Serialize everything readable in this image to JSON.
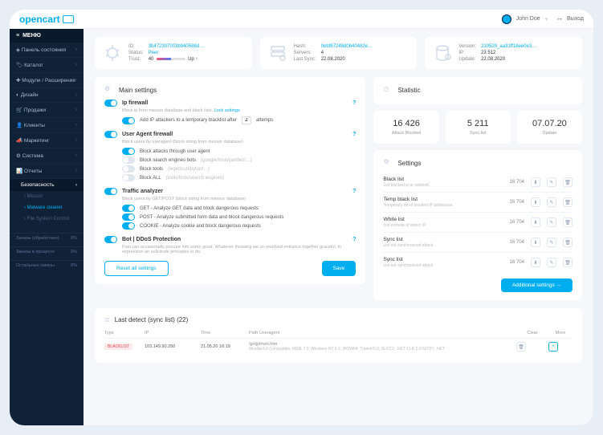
{
  "brand": "opencart",
  "user": {
    "name": "John Doe",
    "exit": "Выход"
  },
  "sidebar": {
    "header": "МЕНЮ",
    "items": [
      {
        "label": "Панель состояния",
        "icon": "dashboard-icon"
      },
      {
        "label": "Каталог",
        "icon": "tag-icon"
      },
      {
        "label": "Модули / Расширения",
        "icon": "puzzle-icon"
      },
      {
        "label": "Дизайн",
        "icon": "palette-icon"
      },
      {
        "label": "Продажи",
        "icon": "cart-icon"
      },
      {
        "label": "Клиенты",
        "icon": "users-icon"
      },
      {
        "label": "Маркетинг",
        "icon": "megaphone-icon"
      },
      {
        "label": "Система",
        "icon": "gear-icon"
      },
      {
        "label": "Отчеты",
        "icon": "chart-icon"
      }
    ],
    "sub_active": "Безопасность",
    "subs": [
      {
        "label": "Messor"
      },
      {
        "label": "Malware cleaner"
      },
      {
        "label": "File System Control"
      }
    ],
    "stats": [
      {
        "label": "Заказы (обработано)",
        "val": "0%"
      },
      {
        "label": "Заказы в процессе",
        "val": "0%"
      },
      {
        "label": "Остальные заказы",
        "val": "0%"
      }
    ]
  },
  "info": {
    "id_label": "ID:",
    "id": "3b472307003b940588d…",
    "status_label": "Status:",
    "status": "Peer",
    "trust_label": "Trust:",
    "trust": "40",
    "trust_dir": "Up ↑",
    "hash_label": "Hash:",
    "hash": "0ebf67248d0b40482e…",
    "servers_label": "Servers:",
    "servers": "4",
    "last_label": "Last Sync:",
    "last": "22.08.2020",
    "version_label": "Version:",
    "version": "210520_aa31ff18ee0e3…",
    "ip_label": "IP:",
    "ip": "23 512",
    "update_label": "Update:",
    "update": "22.08.2020"
  },
  "main_settings": {
    "title": "Main settings",
    "ipfw": {
      "title": "Ip firewall",
      "desc": "Block ip from messor database and black lists.",
      "link": "Lock settings",
      "opt1_pre": "Add IP attackers to a temporary blacklist after",
      "opt1_val": "2",
      "opt1_post": "attemps"
    },
    "uafw": {
      "title": "User Agent firewall",
      "desc": "Block users by useragent (block string from messor database)",
      "o1": "Block attacks through user agent",
      "o2": "Block search engines bots",
      "o2g": "(google/msn/yandex/…)",
      "o3": "Block tools",
      "o3g": "(wget/curl/pyton/…)",
      "o4": "Block ALL",
      "o4g": "(tools/bots/search engines)"
    },
    "traffic": {
      "title": "Traffic analyzer",
      "desc": "Block users by GET/POST (block string from messor database)",
      "o1": "GET - Analyze GET data and block dangerous requests",
      "o2": "POST - Analyze submitted form data and block dangerous requests",
      "o3": "COOKIE - Analyze cookie and block dangerous requests"
    },
    "bot": {
      "title": "Bot | DDoS Protection",
      "desc": "Pain can occasionally procure him some great. Whatever throwing we on resolved entrance together graceful. In expression an solicitude principles in do."
    },
    "reset": "Reset all settings",
    "save": "Save"
  },
  "stats": {
    "title": "Statistic",
    "a_num": "16 426",
    "a_lbl": "Attack Blocked",
    "b_num": "5 211",
    "b_lbl": "Sync list",
    "c_num": "07.07.20",
    "c_lbl": "Update"
  },
  "settings": {
    "title": "Settings",
    "rows": [
      {
        "t": "Black list",
        "d": "List blocked ip or network.",
        "n": "16 704"
      },
      {
        "t": "Temp black list",
        "d": "Temporary list of blocked IP addresses.",
        "n": "16 704"
      },
      {
        "t": "White list",
        "d": "List exclude of detect IP",
        "n": "16 704"
      },
      {
        "t": "Sync list",
        "d": "List not synchronized attack.",
        "n": "16 704"
      },
      {
        "t": "Sync list",
        "d": "List not synchronized attack.",
        "n": "16 704"
      }
    ],
    "more": "Additional settings →"
  },
  "detect": {
    "title": "Last detect (sync list) (22)",
    "cols": {
      "type": "Type",
      "ip": "IP",
      "time": "Time",
      "ua": "Path Useragent",
      "clear": "Clear",
      "more": "More"
    },
    "row": {
      "type": "BLACKLIST",
      "ip": "103.149.90.250",
      "time": "21.05.20 16:19",
      "ua_path": "/gclgi/msn.htm",
      "ua_str": "Mozilla/4.0 (compatible; MSIE 7.0; Windows NT 6.1; WOW64; Trident/5.0; SLCC2; .NET CLR 2.0.50727; .NET"
    }
  }
}
